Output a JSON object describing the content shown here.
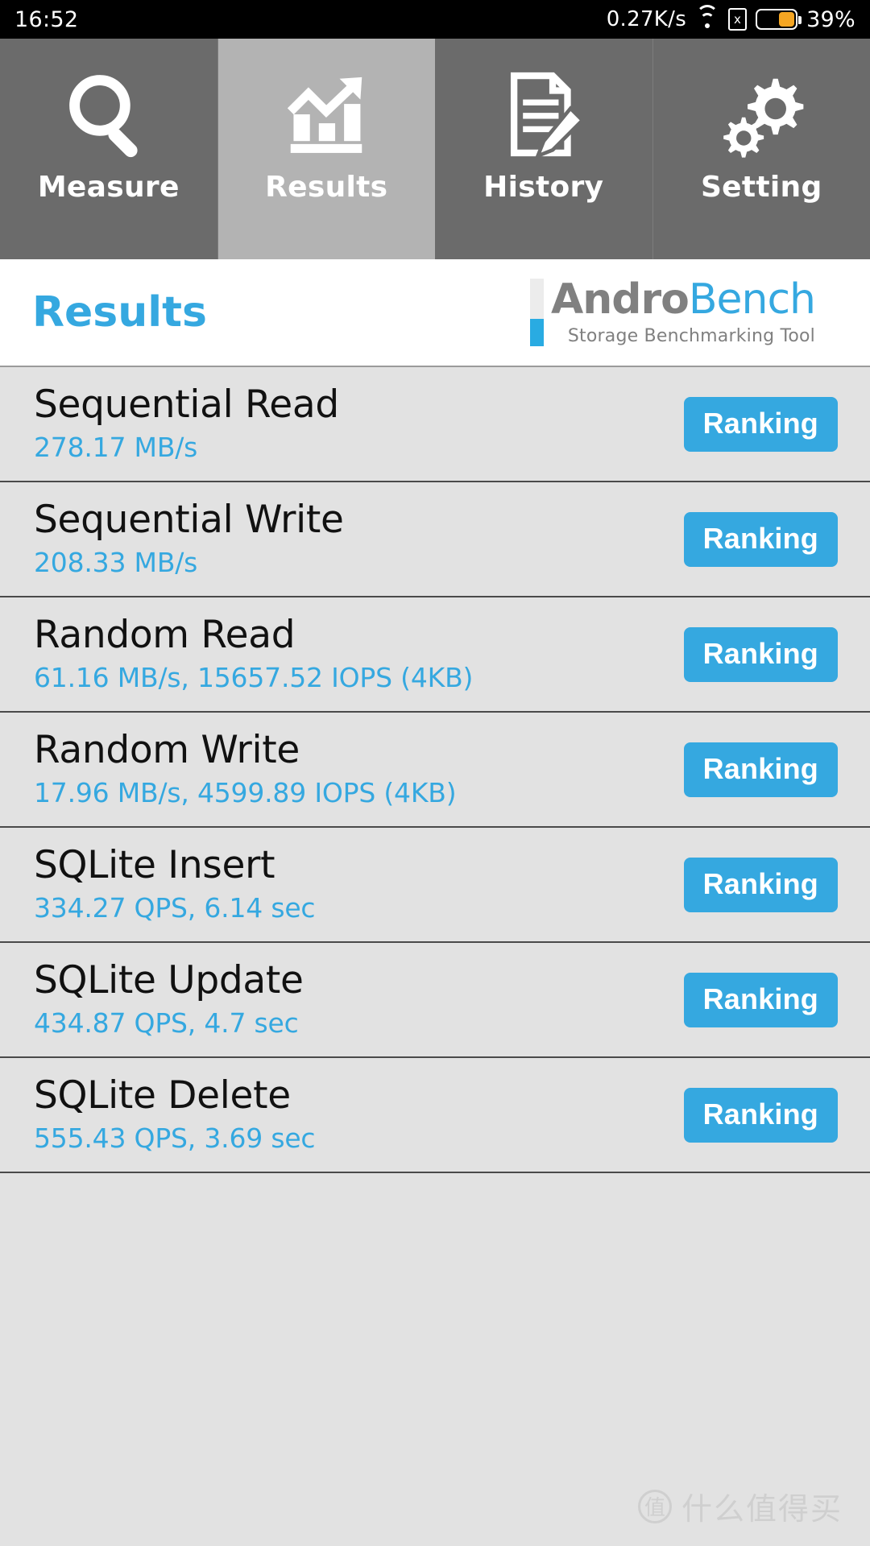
{
  "statusbar": {
    "clock": "16:52",
    "network_speed": "0.27K/s",
    "wifi_icon": "wifi-icon",
    "sim_icon": "sim-no-signal-icon",
    "sim_glyph": "x",
    "battery_icon": "battery-icon",
    "battery_percent": "39%",
    "battery_level": 39
  },
  "tabs": [
    {
      "label": "Measure",
      "icon": "magnifier-icon",
      "active": false
    },
    {
      "label": "Results",
      "icon": "bar-chart-arrow-icon",
      "active": true
    },
    {
      "label": "History",
      "icon": "document-pencil-icon",
      "active": false
    },
    {
      "label": "Setting",
      "icon": "gears-icon",
      "active": false
    }
  ],
  "header": {
    "title": "Results",
    "logo_primary": "Andro",
    "logo_secondary": "Bench",
    "logo_tagline": "Storage Benchmarking Tool"
  },
  "results": {
    "ranking_label": "Ranking",
    "rows": [
      {
        "title": "Sequential Read",
        "value": "278.17 MB/s"
      },
      {
        "title": "Sequential Write",
        "value": "208.33 MB/s"
      },
      {
        "title": "Random Read",
        "value": "61.16 MB/s, 15657.52 IOPS (4KB)"
      },
      {
        "title": "Random Write",
        "value": "17.96 MB/s, 4599.89 IOPS (4KB)"
      },
      {
        "title": "SQLite Insert",
        "value": "334.27 QPS, 6.14 sec"
      },
      {
        "title": "SQLite Update",
        "value": "434.87 QPS, 4.7 sec"
      },
      {
        "title": "SQLite Delete",
        "value": "555.43 QPS, 3.69 sec"
      }
    ]
  },
  "watermark": {
    "logo_glyph": "值",
    "text": "什么值得买"
  },
  "colors": {
    "accent_blue": "#35a8e0",
    "tab_inactive": "#6b6b6b",
    "tab_active": "#b3b3b3",
    "list_bg": "#e2e2e2",
    "battery_orange": "#f5a623"
  }
}
